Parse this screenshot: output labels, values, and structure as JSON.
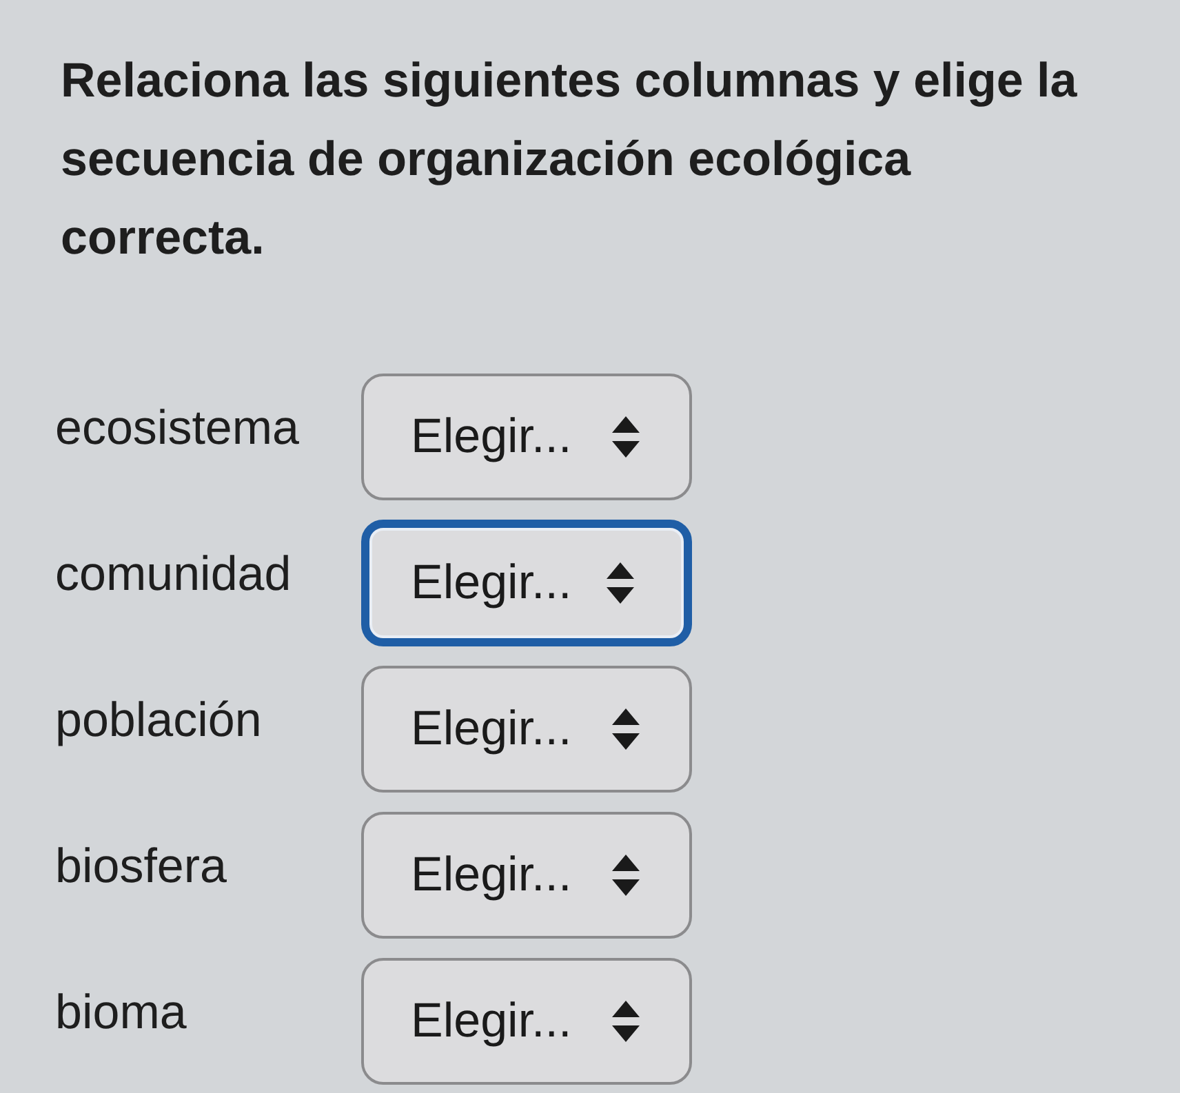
{
  "question": "Relaciona las siguientes columnas y elige la secuencia de organización ecológica correcta.",
  "rows": [
    {
      "label": "ecosistema",
      "select": {
        "value": "Elegir...",
        "focused": false
      }
    },
    {
      "label": "comunidad",
      "select": {
        "value": "Elegir...",
        "focused": true
      }
    },
    {
      "label": "población",
      "select": {
        "value": "Elegir...",
        "focused": false
      }
    },
    {
      "label": "biosfera",
      "select": {
        "value": "Elegir...",
        "focused": false
      }
    },
    {
      "label": "bioma",
      "select": {
        "value": "Elegir...",
        "focused": false
      }
    }
  ]
}
